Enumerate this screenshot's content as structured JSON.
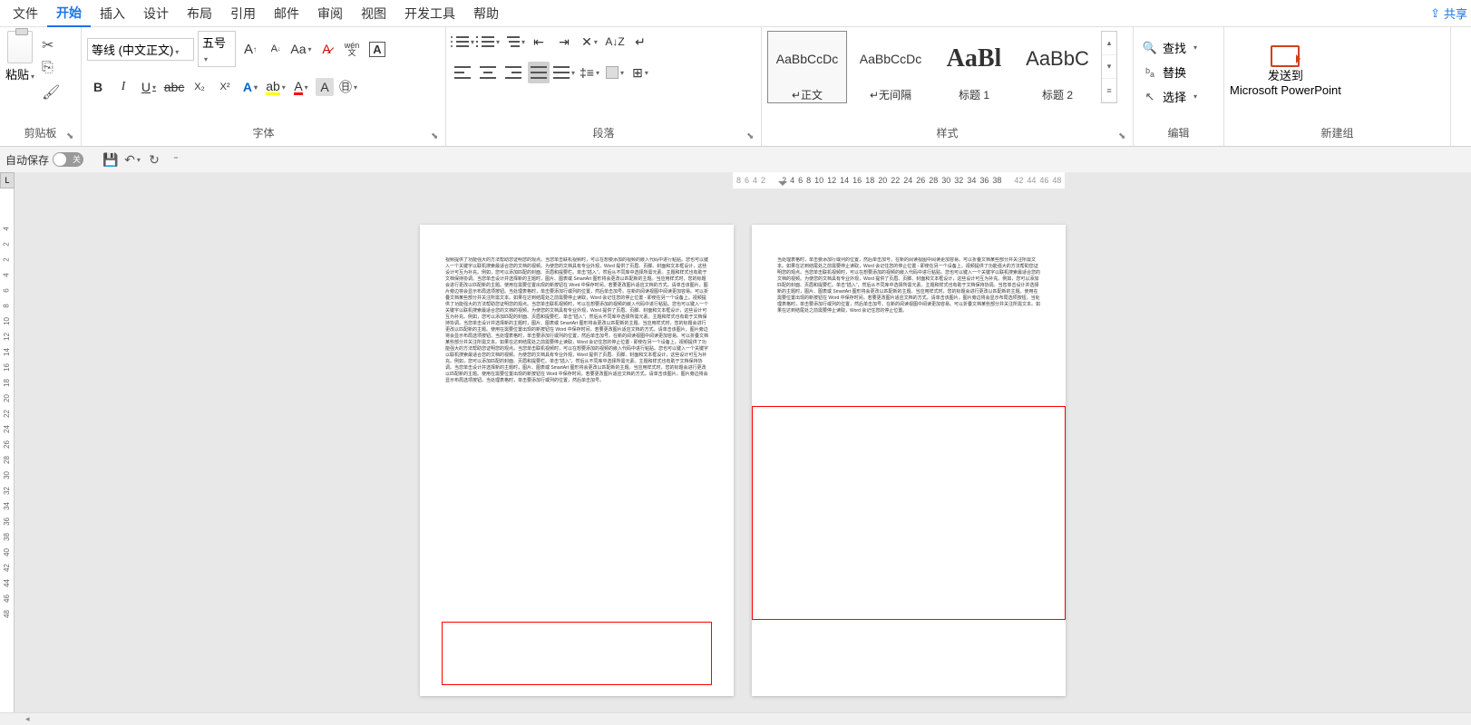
{
  "menu": {
    "items": [
      "文件",
      "开始",
      "插入",
      "设计",
      "布局",
      "引用",
      "邮件",
      "审阅",
      "视图",
      "开发工具",
      "帮助"
    ],
    "active_index": 1,
    "share": "共享"
  },
  "ribbon": {
    "clipboard": {
      "paste": "粘贴",
      "label": "剪贴板"
    },
    "font": {
      "name": "等线 (中文正文)",
      "size": "五号",
      "aa_label": "Aa",
      "wen_ruby": "wén",
      "wen_char": "文",
      "char_border": "A",
      "bold": "B",
      "italic": "I",
      "underline": "U",
      "strike": "abc",
      "sub": "X₂",
      "sup": "X²",
      "effect": "A",
      "label": "字体"
    },
    "paragraph": {
      "sort": "A↓Z",
      "pilcrow": "↵",
      "label": "段落"
    },
    "styles": {
      "items": [
        {
          "preview": "AaBbCcDc",
          "name": "↵正文",
          "cls": "",
          "active": true
        },
        {
          "preview": "AaBbCcDc",
          "name": "↵无间隔",
          "cls": "",
          "active": false
        },
        {
          "preview": "AaBl",
          "name": "标题 1",
          "cls": "h1",
          "active": false
        },
        {
          "preview": "AaBbC",
          "name": "标题 2",
          "cls": "h2",
          "active": false
        }
      ],
      "label": "样式"
    },
    "editing": {
      "find": "查找",
      "replace": "替换",
      "select": "选择",
      "label": "编辑"
    },
    "ppt": {
      "line1": "发送到",
      "line2": "Microsoft PowerPoint",
      "label": "新建组"
    }
  },
  "qat": {
    "autosave": "自动保存"
  },
  "ruler": {
    "left_marks": [
      "8",
      "6",
      "4",
      "2"
    ],
    "right_marks": [
      "2",
      "4",
      "6",
      "8",
      "10",
      "12",
      "14",
      "16",
      "18",
      "20",
      "22",
      "24",
      "26",
      "28",
      "30",
      "32",
      "34",
      "36",
      "38"
    ],
    "far_marks": [
      "42",
      "44",
      "46",
      "48"
    ],
    "vleft": "L"
  },
  "vruler_marks": [
    "4",
    "2",
    "2",
    "4",
    "6",
    "8",
    "10",
    "12",
    "14",
    "16",
    "18",
    "20",
    "22",
    "24",
    "26",
    "28",
    "30",
    "32",
    "34",
    "36",
    "38",
    "40",
    "42",
    "44",
    "46",
    "48"
  ],
  "pages": {
    "p1_text": "视频提供了功能强大的方法帮助您证明您的观点。当您单击联机视频时，可以在想要添加的视频的嵌入代码中进行粘贴。您也可以键入一个关键字以联机搜索最适合您的文档的视频。为使您的文档具有专业外观，Word 提供了页眉、页脚、封面和文本框设计，这些设计可互为补充。例如，您可以添加匹配的封面、页眉和提要栏。单击\"插入\"，然后从不同库中选择所需元素。主题和样式也有助于文档保持协调。当您单击设计并选择新的主题时，图片、图表或 SmartArt 图形将会更改以匹配新的主题。当应用样式时，您的标题会进行更改以匹配新的主题。使用在需要位置出现的新按钮在 Word 中保存时间。若要更改图片适应文档的方式，请单击该图片，图片旁边将会显示布局选项按钮。当处理表格时，单击要添加行或列的位置，然后单击加号。在新的阅读视图中阅读更加容易。可以折叠文档某些部分并关注所需文本。如果在达到结尾处之前需要停止读取，Word 会记住您的停止位置 - 即使在另一个设备上。视频提供了功能强大的方法帮助您证明您的观点。当您单击联机视频时，可以在想要添加的视频的嵌入代码中进行粘贴。您也可以键入一个关键字以联机搜索最适合您的文档的视频。为使您的文档具有专业外观，Word 提供了页眉、页脚、封面和文本框设计，这些设计可互为补充。例如，您可以添加匹配的封面、页眉和提要栏。单击\"插入\"，然后从不同库中选择所需元素。主题和样式也有助于文档保持协调。当您单击设计并选择新的主题时，图片、图表或 SmartArt 图形将会更改以匹配新的主题。当应用样式时，您的标题会进行更改以匹配新的主题。使用在需要位置出现的新按钮在 Word 中保存时间。若要更改图片适应文档的方式，请单击该图片，图片旁边将会显示布局选项按钮。当处理表格时，单击要添加行或列的位置，然后单击加号。在新的阅读视图中阅读更加容易。可以折叠文档某些部分并关注所需文本。如果在达到结尾处之前需要停止读取，Word 会记住您的停止位置 - 即使在另一个设备上。视频提供了功能强大的方法帮助您证明您的观点。当您单击联机视频时，可以在想要添加的视频的嵌入代码中进行粘贴。您也可以键入一个关键字以联机搜索最适合您的文档的视频。为使您的文档具有专业外观，Word 提供了页眉、页脚、封面和文本框设计，这些设计可互为补充。例如，您可以添加匹配的封面、页眉和提要栏。单击\"插入\"，然后从不同库中选择所需元素。主题和样式也有助于文档保持协调。当您单击设计并选择新的主题时，图片、图表或 SmartArt 图形将会更改以匹配新的主题。当应用样式时，您的标题会进行更改以匹配新的主题。使用在需要位置出现的新按钮在 Word 中保存时间。若要更改图片适应文档的方式，请单击该图片，图片旁边将会显示布局选项按钮。当处理表格时，单击要添加行或列的位置，然后单击加号。",
    "p2_text": "当处理表格时，单击要添加行或列的位置，然后单击加号。在新的阅读视图中阅读更加容易。可以折叠文档某些部分并关注所需文本。如果在达到结尾处之前需要停止读取，Word 会记住您的停止位置 - 即使在另一个设备上。视频提供了功能强大的方法帮助您证明您的观点。当您单击联机视频时，可以在想要添加的视频的嵌入代码中进行粘贴。您也可以键入一个关键字以联机搜索最适合您的文档的视频。为使您的文档具有专业外观，Word 提供了页眉、页脚、封面和文本框设计，这些设计可互为补充。例如，您可以添加匹配的封面、页眉和提要栏。单击\"插入\"，然后从不同库中选择所需元素。主题和样式也有助于文档保持协调。当您单击设计并选择新的主题时，图片、图表或 SmartArt 图形将会更改以匹配新的主题。当应用样式时，您的标题会进行更改以匹配新的主题。使用在需要位置出现的新按钮在 Word 中保存时间。若要更改图片适应文档的方式，请单击该图片，图片旁边将会显示布局选项按钮。当处理表格时，单击要添加行或列的位置，然后单击加号。在新的阅读视图中阅读更加容易。可以折叠文档某些部分并关注所需文本。如果在达到结尾处之前需要停止读取，Word 会记住您的停止位置。"
  }
}
